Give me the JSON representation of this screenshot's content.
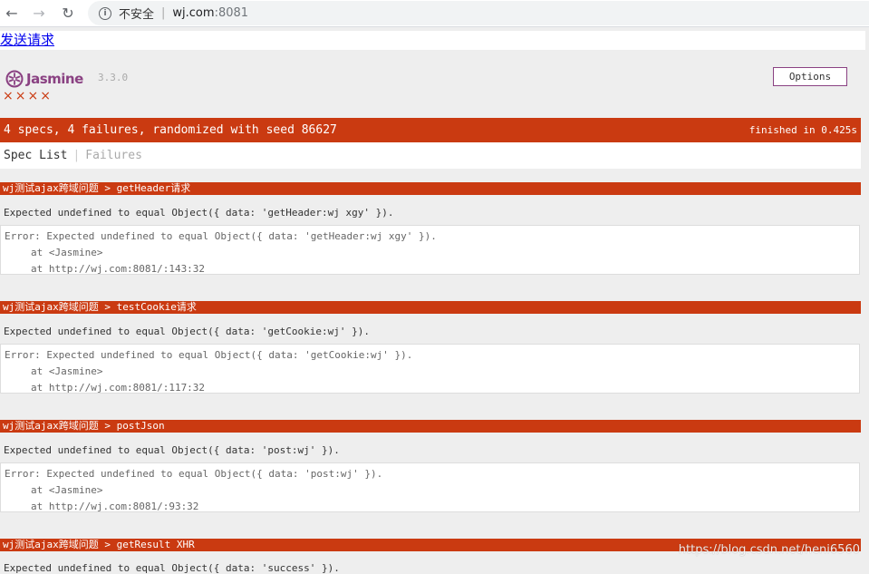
{
  "browser": {
    "insecure_label": "不安全",
    "url_host": "wj.com",
    "url_port": ":8081"
  },
  "page": {
    "send_link": "发送请求"
  },
  "jasmine": {
    "logo_text": "Jasmine",
    "version": "3.3.0",
    "options_label": "Options",
    "failure_marks": "××××",
    "summary": "4 specs, 4 failures, randomized with seed 86627",
    "finished": "finished in 0.425s",
    "tab_spec_list": "Spec List",
    "tab_separator": "|",
    "tab_failures": "Failures",
    "accent_color": "#8a4182",
    "failure_color": "#ca3a11"
  },
  "failures": [
    {
      "header": "wj测试ajax跨域问题 > getHeader请求",
      "message": "Expected undefined to equal Object({ data: 'getHeader:wj xgy' }).",
      "stack": [
        "Error: Expected undefined to equal Object({ data: 'getHeader:wj xgy' }).",
        "at <Jasmine>",
        "at http://wj.com:8081/:143:32"
      ]
    },
    {
      "header": "wj测试ajax跨域问题 > testCookie请求",
      "message": "Expected undefined to equal Object({ data: 'getCookie:wj' }).",
      "stack": [
        "Error: Expected undefined to equal Object({ data: 'getCookie:wj' }).",
        "at <Jasmine>",
        "at http://wj.com:8081/:117:32"
      ]
    },
    {
      "header": "wj测试ajax跨域问题 > postJson",
      "message": "Expected undefined to equal Object({ data: 'post:wj' }).",
      "stack": [
        "Error: Expected undefined to equal Object({ data: 'post:wj' }).",
        "at <Jasmine>",
        "at http://wj.com:8081/:93:32"
      ]
    },
    {
      "header": "wj测试ajax跨域问题 > getResult XHR",
      "message": "Expected undefined to equal Object({ data: 'success' })."
    }
  ],
  "watermark": "https://blog.csdn.net/heni6560"
}
